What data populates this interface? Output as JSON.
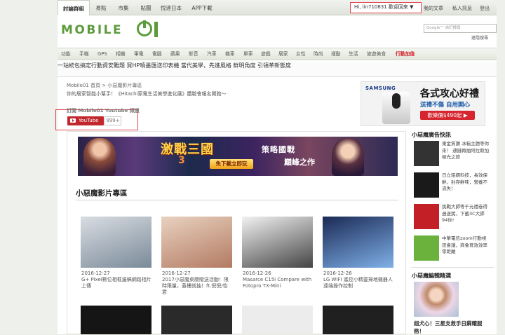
{
  "topbar": {
    "tabs": [
      "討論群組",
      "易點",
      "市集",
      "貼圖",
      "悅達日本",
      "APP下載"
    ],
    "user_greeting": "Hi, lin710831 歡迎回來 ▼",
    "links": [
      "我的文章",
      "私人訊息",
      "登出"
    ]
  },
  "logo": {
    "text": "MOBILE"
  },
  "search": {
    "placeholder": "Google™ 自訂搜尋",
    "advanced_label": "進階搜尋"
  },
  "nav": {
    "items": [
      "功能",
      "手機",
      "GPS",
      "相機",
      "筆電",
      "電腦",
      "蘋果",
      "影音",
      "汽車",
      "機車",
      "單車",
      "遊戲",
      "居家",
      "女性",
      "時尚",
      "運動",
      "生活",
      "旅遊美食",
      "行動加值"
    ],
    "highlight_index": 18
  },
  "promo": {
    "links": [
      "一站統包搞定行動資安難題",
      "買HP噴墨匯送印表機",
      "當代美學，先進風格",
      "鮮明角度 引領革新態度"
    ]
  },
  "breadcrumb": {
    "text": "Mobile01 首頁 > 小惡魔影片專區"
  },
  "headline": {
    "text": "你的居家智能小幫手！《Hitachi家電生活美學進化展》體驗會報名開跑～"
  },
  "subscribe": {
    "title": "訂閱 Mobile01 Youtube 頻道",
    "button_label": "YouTube",
    "count": "999+"
  },
  "banner": {
    "title": "激戰三國",
    "num": "3",
    "cta": "免下載立即玩",
    "slogan": "策略國戰",
    "slogan2": "巔峰之作"
  },
  "section": {
    "title": "小惡魔影片專區"
  },
  "videos": [
    {
      "date": "2016-12-27",
      "caption": "G+ Pixel數位相框邊稿網路相片上傳",
      "colors": [
        "#d9dde2",
        "#7a8a99"
      ]
    },
    {
      "date": "2016-12-27",
      "caption": "2017小惡魔桌曆贈送活動！限時限量，蓋樓就抽！ft.倪倪/怡君",
      "colors": [
        "#e8d2c0",
        "#b37a62"
      ]
    },
    {
      "date": "2016-12-26",
      "caption": "Masarce C15i Compare with Fotopro TX-Mini",
      "colors": [
        "#f2f2f2",
        "#444444"
      ]
    },
    {
      "date": "2016-12-26",
      "caption": "LG WIFI 遙控小精靈掃地機器人遠端操作控制",
      "colors": [
        "#1b2a55",
        "#7fb0e8"
      ]
    }
  ],
  "right_ad": {
    "brand": "SAMSUNG",
    "headline": "各式攻心好禮",
    "sub": "送禮不傷 自用開心",
    "cta": "歡樂價$490起 ▶"
  },
  "sidebar": {
    "ads_title": "小惡魔廣告快訊",
    "ads": [
      {
        "text": "東金質讚 冰箱主題等你來！ 通鏈再抽阿拉斯加極光之旅",
        "color": "#333333"
      },
      {
        "text": "日立鋁鋼科技，長效保鮮，封存鮮味，營養不流失！",
        "color": "#1a1a1a"
      },
      {
        "text": "挑戰大師等千元禮卷得週送獎，下載3C大師94你!",
        "color": "#c31f27"
      },
      {
        "text": "中華電信zoom行動視訊會議，商會育效效率零距離",
        "color": "#6ab23c"
      }
    ],
    "feature_title": "小惡魔編輯精選",
    "feature_caption": "超犬心！三星支救手日蘇耀服務！"
  }
}
